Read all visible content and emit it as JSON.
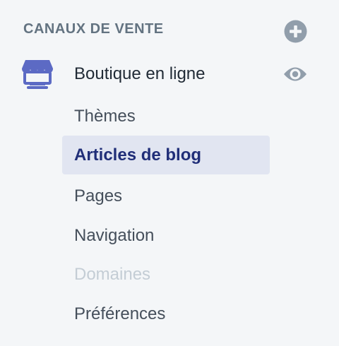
{
  "section": {
    "title": "CANAUX DE VENTE"
  },
  "channel": {
    "name": "Boutique en ligne"
  },
  "nav": {
    "items": [
      {
        "label": "Thèmes"
      },
      {
        "label": "Articles de blog"
      },
      {
        "label": "Pages"
      },
      {
        "label": "Navigation"
      },
      {
        "label": "Domaines"
      },
      {
        "label": "Préférences"
      }
    ]
  },
  "colors": {
    "background": "#f4f6f8",
    "icon_gray": "#919eab",
    "store_icon": "#5c6ac4",
    "active_bg": "#e1e5f1",
    "active_text": "#202e78",
    "disabled_text": "#c4cdd5"
  },
  "icons": {
    "add": "plus-circle-icon",
    "store": "storefront-icon",
    "view": "eye-icon"
  }
}
